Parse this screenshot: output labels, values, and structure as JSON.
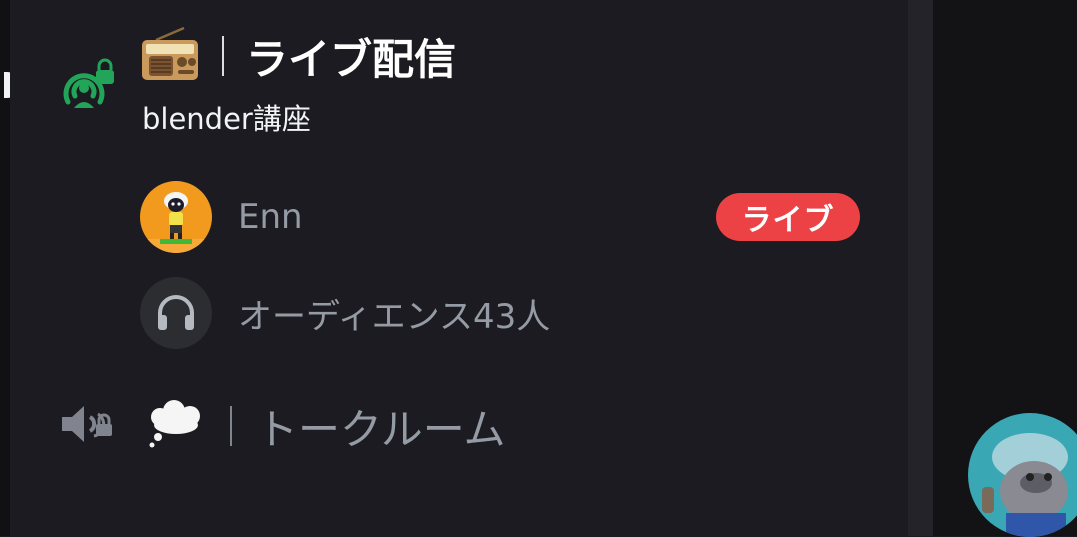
{
  "stage_channel": {
    "emoji_icon": "radio-emoji",
    "title": "ライブ配信",
    "topic": "blender講座",
    "status_icon": "stage-locked-icon"
  },
  "participants": [
    {
      "name": "Enn",
      "badge": "ライブ",
      "avatar_icon": "sheep-avatar"
    }
  ],
  "audience": {
    "label": "オーディエンス43人",
    "icon": "headphones-icon"
  },
  "voice_channel": {
    "emoji_icon": "thought-bubble-emoji",
    "name": "トークルーム",
    "status_icon": "speaker-locked-icon"
  },
  "colors": {
    "background": "#1b1b21",
    "live_badge": "#ed4245",
    "stage_icon": "#23a559",
    "muted_text": "#949ba4"
  }
}
